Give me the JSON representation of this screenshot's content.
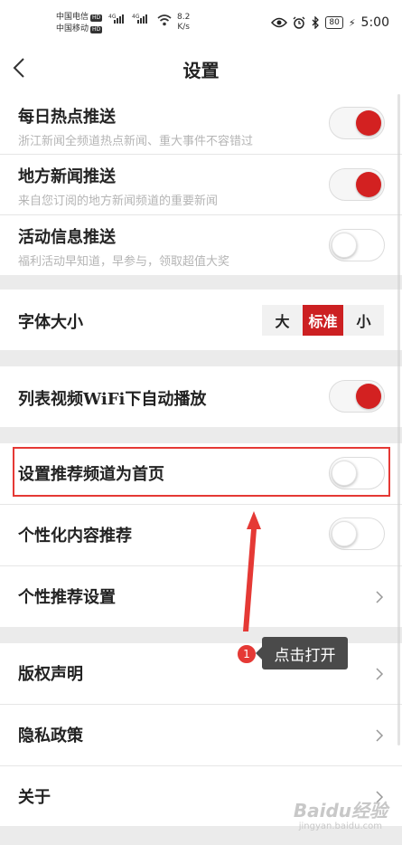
{
  "status_bar": {
    "carrier1": "中国电信",
    "carrier2": "中国移动",
    "hd": "HD",
    "net_type": "4G",
    "speed_value": "8.2",
    "speed_unit": "K/s",
    "battery": "80",
    "time": "5:00"
  },
  "header": {
    "title": "设置"
  },
  "push_settings": [
    {
      "title": "每日热点推送",
      "subtitle": "浙江新闻全频道热点新闻、重大事件不容错过",
      "enabled": true
    },
    {
      "title": "地方新闻推送",
      "subtitle": "来自您订阅的地方新闻频道的重要新闻",
      "enabled": true
    },
    {
      "title": "活动信息推送",
      "subtitle": "福利活动早知道，早参与，领取超值大奖",
      "enabled": false
    }
  ],
  "font_size": {
    "label": "字体大小",
    "options": [
      "大",
      "标准",
      "小"
    ],
    "selected": "标准"
  },
  "video": {
    "label": "列表视频WiFi下自动播放",
    "enabled": true
  },
  "recommend": {
    "home_channel": {
      "label": "设置推荐频道为首页",
      "enabled": false
    },
    "personalized": {
      "label": "个性化内容推荐",
      "enabled": false
    },
    "settings": {
      "label": "个性推荐设置"
    }
  },
  "about_section": {
    "copyright": "版权声明",
    "privacy": "隐私政策",
    "about": "关于"
  },
  "annotation": {
    "step": "1",
    "tooltip": "点击打开"
  },
  "watermark": {
    "text": "Baidu经验",
    "url": "jingyan.baidu.com"
  },
  "colors": {
    "accent": "#d32121",
    "annotation": "#e53935"
  }
}
